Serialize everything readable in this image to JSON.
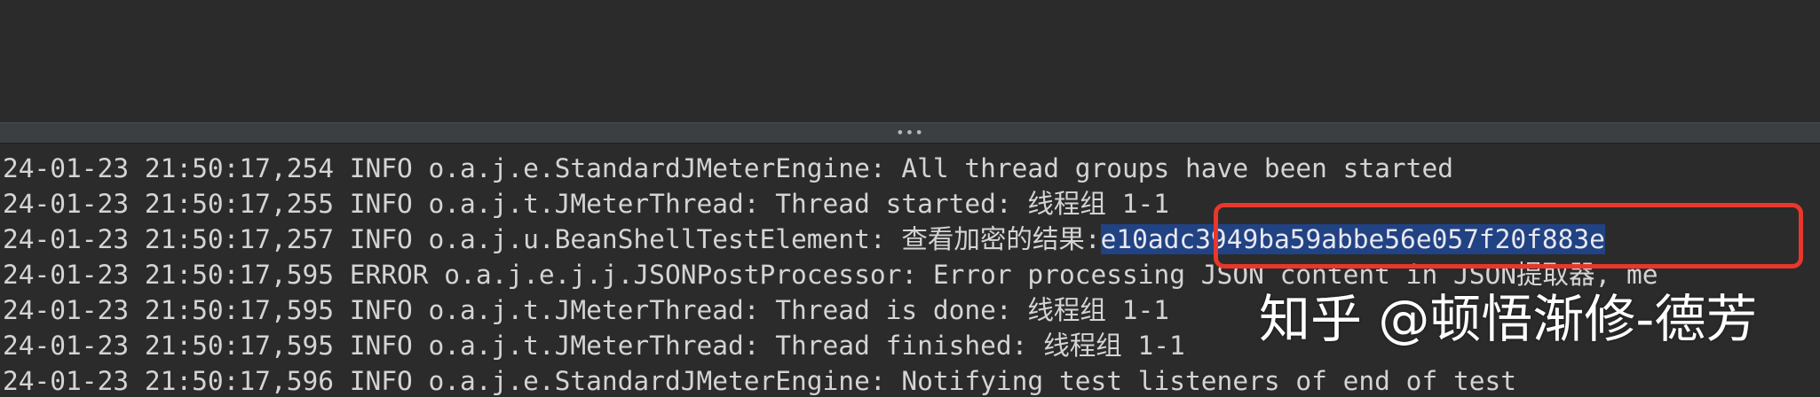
{
  "splitter": {
    "grip": "•••"
  },
  "log": {
    "lines": [
      {
        "text": "24-01-23 21:50:17,254 INFO o.a.j.e.StandardJMeterEngine: All thread groups have been started"
      },
      {
        "text": "24-01-23 21:50:17,255 INFO o.a.j.t.JMeterThread: Thread started: 线程组 1-1"
      },
      {
        "prefix": "24-01-23 21:50:17,257 INFO o.a.j.u.BeanShellTestElement: 查看加密的结果:",
        "highlight": "e10adc3949ba59abbe56e057f20f883e"
      },
      {
        "text": "24-01-23 21:50:17,595 ERROR o.a.j.e.j.j.JSONPostProcessor: Error processing JSON content in JSON提取器, me"
      },
      {
        "text": "24-01-23 21:50:17,595 INFO o.a.j.t.JMeterThread: Thread is done: 线程组 1-1"
      },
      {
        "text": "24-01-23 21:50:17,595 INFO o.a.j.t.JMeterThread: Thread finished: 线程组 1-1"
      },
      {
        "text": "24-01-23 21:50:17,596 INFO o.a.j.e.StandardJMeterEngine: Notifying test listeners of end of test"
      }
    ]
  },
  "annotation": {
    "color": "#e8372c"
  },
  "selection": {
    "color": "#214283"
  },
  "watermark": {
    "text": "知乎 @顿悟渐修-德芳"
  }
}
